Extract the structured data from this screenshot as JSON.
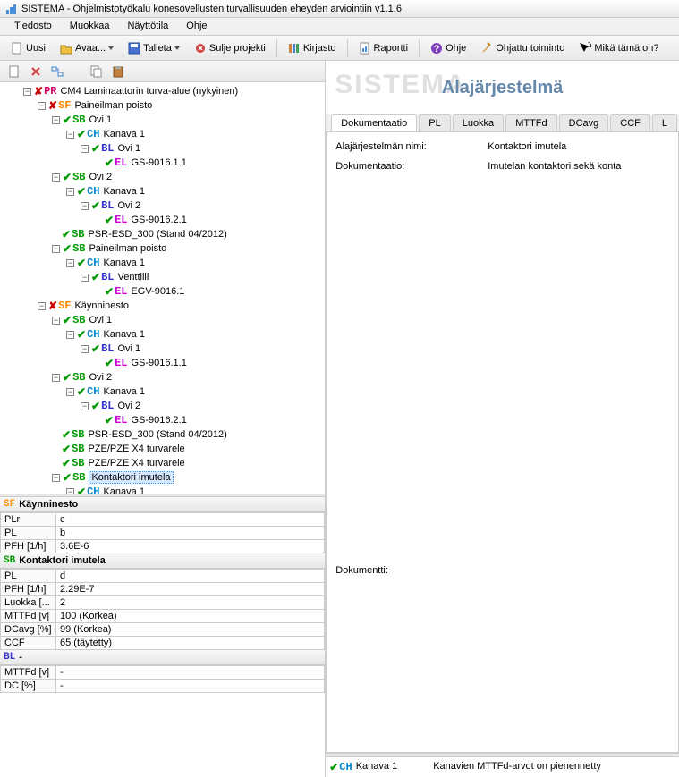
{
  "window": {
    "title": "SISTEMA - Ohjelmistotyökalu konesovellusten turvallisuuden eheyden arviointiin v1.1.6"
  },
  "menu": {
    "file": "Tiedosto",
    "edit": "Muokkaa",
    "view": "Näyttötila",
    "help": "Ohje"
  },
  "toolbar": {
    "new": "Uusi",
    "open": "Avaa...",
    "save": "Talleta",
    "close": "Sulje projekti",
    "library": "Kirjasto",
    "report": "Raportti",
    "help": "Ohje",
    "wizard": "Ohjattu toiminto",
    "whatsthis": "Mikä tämä on?"
  },
  "tree": [
    {
      "d": 1,
      "e": "-",
      "m": "x",
      "t": "PR",
      "l": "CM4 Laminaattorin turva-alue (nykyinen)"
    },
    {
      "d": 2,
      "e": "-",
      "m": "x",
      "t": "SF",
      "l": "Paineilman poisto"
    },
    {
      "d": 3,
      "e": "-",
      "m": "v",
      "t": "SB",
      "l": "Ovi 1"
    },
    {
      "d": 4,
      "e": "-",
      "m": "v",
      "t": "CH",
      "l": "Kanava 1"
    },
    {
      "d": 5,
      "e": "-",
      "m": "v",
      "t": "BL",
      "l": "Ovi 1"
    },
    {
      "d": 6,
      "e": "",
      "m": "v",
      "t": "EL",
      "l": "GS-9016.1.1"
    },
    {
      "d": 3,
      "e": "-",
      "m": "v",
      "t": "SB",
      "l": "Ovi 2"
    },
    {
      "d": 4,
      "e": "-",
      "m": "v",
      "t": "CH",
      "l": "Kanava 1"
    },
    {
      "d": 5,
      "e": "-",
      "m": "v",
      "t": "BL",
      "l": "Ovi 2"
    },
    {
      "d": 6,
      "e": "",
      "m": "v",
      "t": "EL",
      "l": "GS-9016.2.1"
    },
    {
      "d": 3,
      "e": "",
      "m": "v",
      "t": "SB",
      "l": "PSR-ESD_300 (Stand 04/2012)"
    },
    {
      "d": 3,
      "e": "-",
      "m": "v",
      "t": "SB",
      "l": "Paineilman poisto"
    },
    {
      "d": 4,
      "e": "-",
      "m": "v",
      "t": "CH",
      "l": "Kanava 1"
    },
    {
      "d": 5,
      "e": "-",
      "m": "v",
      "t": "BL",
      "l": "Venttiili"
    },
    {
      "d": 6,
      "e": "",
      "m": "v",
      "t": "EL",
      "l": "EGV-9016.1"
    },
    {
      "d": 2,
      "e": "-",
      "m": "x",
      "t": "SF",
      "l": "Käynninesto"
    },
    {
      "d": 3,
      "e": "-",
      "m": "v",
      "t": "SB",
      "l": "Ovi 1"
    },
    {
      "d": 4,
      "e": "-",
      "m": "v",
      "t": "CH",
      "l": "Kanava 1"
    },
    {
      "d": 5,
      "e": "-",
      "m": "v",
      "t": "BL",
      "l": "Ovi 1"
    },
    {
      "d": 6,
      "e": "",
      "m": "v",
      "t": "EL",
      "l": "GS-9016.1.1"
    },
    {
      "d": 3,
      "e": "-",
      "m": "v",
      "t": "SB",
      "l": "Ovi 2"
    },
    {
      "d": 4,
      "e": "-",
      "m": "v",
      "t": "CH",
      "l": "Kanava 1"
    },
    {
      "d": 5,
      "e": "-",
      "m": "v",
      "t": "BL",
      "l": "Ovi 2"
    },
    {
      "d": 6,
      "e": "",
      "m": "v",
      "t": "EL",
      "l": "GS-9016.2.1"
    },
    {
      "d": 3,
      "e": "",
      "m": "v",
      "t": "SB",
      "l": "PSR-ESD_300 (Stand 04/2012)"
    },
    {
      "d": 3,
      "e": "",
      "m": "v",
      "t": "SB",
      "l": "PZE/PZE X4  turvarele"
    },
    {
      "d": 3,
      "e": "",
      "m": "v",
      "t": "SB",
      "l": "PZE/PZE X4  turvarele"
    },
    {
      "d": 3,
      "e": "-",
      "m": "v",
      "t": "SB",
      "l": "Kontaktori imutela",
      "sel": true
    },
    {
      "d": 4,
      "e": "-",
      "m": "v",
      "t": "CH",
      "l": "Kanava 1"
    }
  ],
  "panel1": {
    "tag": "SF",
    "title": "Käynninesto",
    "rows": [
      [
        "PLr",
        "c"
      ],
      [
        "PL",
        "b"
      ],
      [
        "PFH [1/h]",
        "3.6E-6"
      ]
    ]
  },
  "panel2": {
    "tag": "SB",
    "title": "Kontaktori imutela",
    "rows": [
      [
        "PL",
        "d"
      ],
      [
        "PFH [1/h]",
        "2.29E-7"
      ],
      [
        "Luokka [...",
        "2"
      ],
      [
        "MTTFd [v]",
        "100 (Korkea)"
      ],
      [
        "DCavg [%]",
        "99 (Korkea)"
      ],
      [
        "CCF",
        "65 (täytetty)"
      ]
    ]
  },
  "panel3": {
    "tag": "BL",
    "title": "-",
    "rows": [
      [
        "MTTFd [v]",
        "-"
      ],
      [
        "DC [%]",
        "-"
      ]
    ]
  },
  "right": {
    "watermark": "SISTEMA",
    "heading": "Alajärjestelmä",
    "tabs": [
      "Dokumentaatio",
      "PL",
      "Luokka",
      "MTTFd",
      "DCavg",
      "CCF",
      "L"
    ],
    "activeTab": 0,
    "nameLabel": "Alajärjestelmän nimi:",
    "nameValue": "Kontaktori imutela",
    "docLabel": "Dokumentaatio:",
    "docValue": "Imutelan kontaktori sekä konta",
    "documentLabel": "Dokumentti:",
    "status": {
      "tag": "CH",
      "name": "Kanava 1",
      "msg": "Kanavien MTTFd-arvot on pienennetty"
    }
  }
}
